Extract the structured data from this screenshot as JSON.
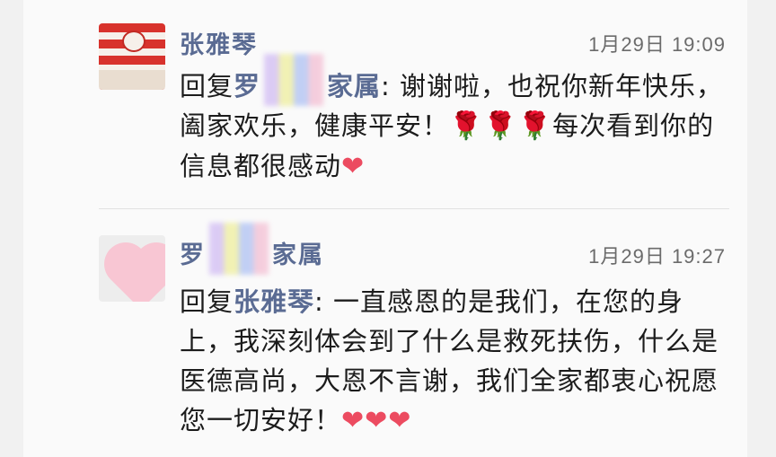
{
  "comments": [
    {
      "name": "张雅琴",
      "time": "1月29日 19:09",
      "reply_prefix": "回复",
      "reply_to_before": "罗",
      "reply_to_after": "家属",
      "text": ": 谢谢啦，也祝你新年快乐，阖家欢乐，健康平安！",
      "emoji_flowers": "🌹🌹🌹",
      "text_after": "每次看到你的信息都很感动",
      "emoji_heart": "❤"
    },
    {
      "name_before": "罗",
      "name_after": "家属",
      "time": "1月29日 19:27",
      "reply_prefix": "回复",
      "reply_to": "张雅琴",
      "text": ": 一直感恩的是我们，在您的身上，我深刻体会到了什么是救死扶伤，什么是医德高尚，大恩不言谢，我们全家都衷心祝愿您一切安好！",
      "emoji_hearts": "❤❤❤"
    }
  ],
  "colors": {
    "name": "#5a6b93",
    "text": "#1c1c1c",
    "time": "#6b6b6b",
    "heart": "#ec4b60",
    "background": "#fafafa"
  },
  "icons": {
    "avatar_1": "red-white-striped-avatar",
    "avatar_2": "pink-heart-avatar",
    "blur": "pixelated-redaction"
  }
}
